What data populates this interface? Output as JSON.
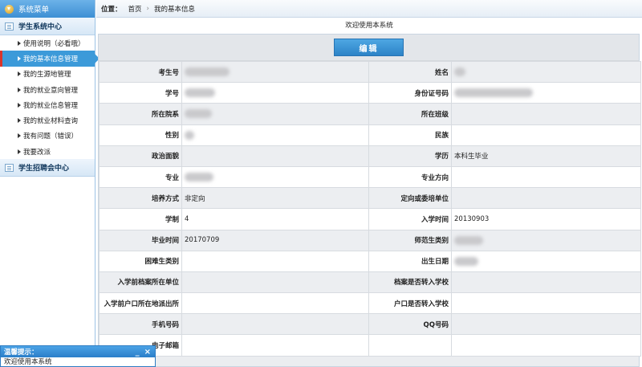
{
  "sidebar": {
    "title": "系统菜单",
    "sections": [
      {
        "label": "学生系统中心",
        "items": [
          {
            "label": "使用说明（必看哦）",
            "active": false
          },
          {
            "label": "我的基本信息管理",
            "active": true
          },
          {
            "label": "我的生源地管理",
            "active": false
          },
          {
            "label": "我的就业意向管理",
            "active": false
          },
          {
            "label": "我的就业信息管理",
            "active": false
          },
          {
            "label": "我的就业材料查询",
            "active": false
          },
          {
            "label": "我有问题（错误）",
            "active": false
          },
          {
            "label": "我要改派",
            "active": false
          }
        ]
      },
      {
        "label": "学生招聘会中心",
        "items": []
      }
    ]
  },
  "breadcrumb": {
    "label": "位置：",
    "home": "首页",
    "current": "我的基本信息"
  },
  "welcome": "欢迎使用本系统",
  "edit_button": "编辑",
  "rows": [
    {
      "l1": "考生号",
      "v1": "",
      "l2": "姓名",
      "v2": ""
    },
    {
      "l1": "学号",
      "v1": "",
      "l2": "身份证号码",
      "v2": ""
    },
    {
      "l1": "所在院系",
      "v1": "",
      "l2": "所在班级",
      "v2": ""
    },
    {
      "l1": "性别",
      "v1": "",
      "l2": "民族",
      "v2": ""
    },
    {
      "l1": "政治面貌",
      "v1": "",
      "l2": "学历",
      "v2": "本科生毕业"
    },
    {
      "l1": "专业",
      "v1": "",
      "l2": "专业方向",
      "v2": ""
    },
    {
      "l1": "培养方式",
      "v1": "非定向",
      "l2": "定向或委培单位",
      "v2": ""
    },
    {
      "l1": "学制",
      "v1": "4",
      "l2": "入学时间",
      "v2": "20130903"
    },
    {
      "l1": "毕业时间",
      "v1": "20170709",
      "l2": "师范生类别",
      "v2": ""
    },
    {
      "l1": "困难生类别",
      "v1": "",
      "l2": "出生日期",
      "v2": ""
    },
    {
      "l1": "入学前档案所在单位",
      "v1": "",
      "l2": "档案是否转入学校",
      "v2": ""
    },
    {
      "l1": "入学前户口所在地派出所",
      "v1": "",
      "l2": "户口是否转入学校",
      "v2": ""
    },
    {
      "l1": "手机号码",
      "v1": "",
      "l2": "QQ号码",
      "v2": ""
    },
    {
      "l1": "电子邮箱",
      "v1": "",
      "l2": "",
      "v2": ""
    }
  ],
  "tip": {
    "title": "温馨提示：",
    "body": "欢迎使用本系统",
    "minimize": "_",
    "close": "×"
  }
}
